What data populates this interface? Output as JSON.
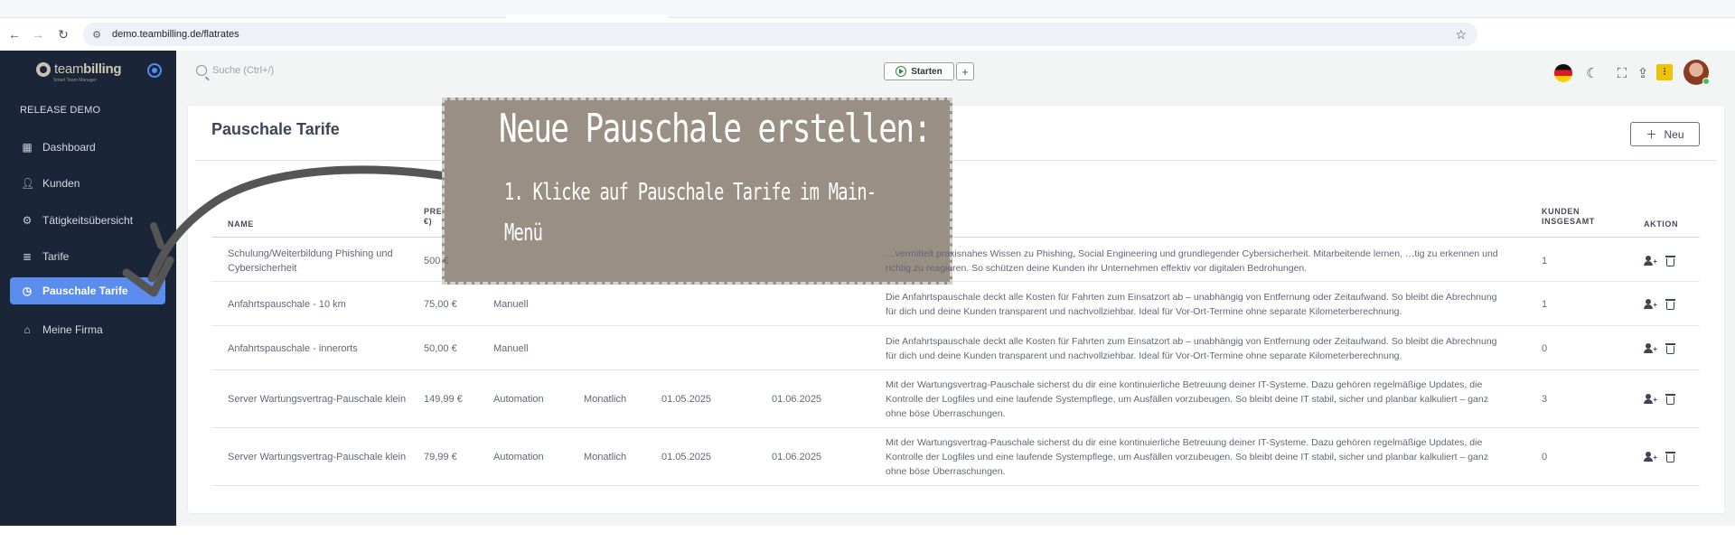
{
  "browser": {
    "url": "demo.teambilling.de/flatrates"
  },
  "sidebar": {
    "logo_bold": "billing",
    "logo_thin": "team",
    "logo_sub": "Smart Team Manager",
    "release": "RELEASE DEMO",
    "items": [
      {
        "label": "Dashboard",
        "icon": "dashboard-icon"
      },
      {
        "label": "Kunden",
        "icon": "user-icon"
      },
      {
        "label": "Tätigkeitsübersicht",
        "icon": "gears-icon"
      },
      {
        "label": "Tarife",
        "icon": "database-icon"
      },
      {
        "label": "Pauschale Tarife",
        "icon": "clock-icon",
        "active": true
      },
      {
        "label": "Meine Firma",
        "icon": "home-icon"
      }
    ]
  },
  "topbar": {
    "search_placeholder": "Suche (Ctrl+/)",
    "start_label": "Starten",
    "add_label": "+"
  },
  "card": {
    "title": "Pauschale Tarife",
    "new_label": "Neu"
  },
  "table": {
    "headers": {
      "name": "NAME",
      "preis_l1": "PRE",
      "preis_l2": "€)",
      "kunden_l1": "KUNDEN",
      "kunden_l2": "INSGESAMT",
      "aktion": "AKTION"
    },
    "rows": [
      {
        "name": "Schulung/Weiterbildung Phishing und Cybersicherheit",
        "preis": "500 €",
        "typ": "",
        "intervall": "",
        "start": "",
        "ende": "",
        "beschreibung": "…vermittelt praxisnahes Wissen zu Phishing, Social Engineering und grundlegender Cybersicherheit. Mitarbeitende lernen, …tig zu erkennen und richtig zu reagieren. So schützen deine Kunden ihr Unternehmen effektiv vor digitalen Bedrohungen.",
        "kunden": "1"
      },
      {
        "name": "Anfahrtspauschale - 10 km",
        "preis": "75,00 €",
        "typ": "Manuell",
        "intervall": "",
        "start": "",
        "ende": "",
        "beschreibung": "Die Anfahrtspauschale deckt alle Kosten für Fahrten zum Einsatzort ab – unabhängig von Entfernung oder Zeitaufwand. So bleibt die Abrechnung für dich und deine Kunden transparent und nachvollziehbar. Ideal für Vor-Ort-Termine ohne separate Kilometerberechnung.",
        "kunden": "1"
      },
      {
        "name": "Anfahrtspauschale - innerorts",
        "preis": "50,00 €",
        "typ": "Manuell",
        "intervall": "",
        "start": "",
        "ende": "",
        "beschreibung": "Die Anfahrtspauschale deckt alle Kosten für Fahrten zum Einsatzort ab – unabhängig von Entfernung oder Zeitaufwand. So bleibt die Abrechnung für dich und deine Kunden transparent und nachvollziehbar. Ideal für Vor-Ort-Termine ohne separate Kilometerberechnung.",
        "kunden": "0"
      },
      {
        "name": "Server Wartungsvertrag-Pauschale klein",
        "preis": "149,99 €",
        "typ": "Automation",
        "intervall": "Monatlich",
        "start": "01.05.2025",
        "ende": "01.06.2025",
        "beschreibung": "Mit der Wartungsvertrag-Pauschale sicherst du dir eine kontinuierliche Betreuung deiner IT-Systeme. Dazu gehören regelmäßige Updates, die Kontrolle der Logfiles und eine laufende Systempflege, um Ausfällen vorzubeugen. So bleibt deine IT stabil, sicher und planbar kalkuliert – ganz ohne böse Überraschungen.",
        "kunden": "3"
      },
      {
        "name": "Server Wartungsvertrag-Pauschale klein",
        "preis": "79,99 €",
        "typ": "Automation",
        "intervall": "Monatlich",
        "start": "01.05.2025",
        "ende": "01.06.2025",
        "beschreibung": "Mit der Wartungsvertrag-Pauschale sicherst du dir eine kontinuierliche Betreuung deiner IT-Systeme. Dazu gehören regelmäßige Updates, die Kontrolle der Logfiles und eine laufende Systempflege, um Ausfällen vorzubeugen. So bleibt deine IT stabil, sicher und planbar kalkuliert – ganz ohne böse Überraschungen.",
        "kunden": "0"
      }
    ]
  },
  "overlay": {
    "title": "Neue Pauschale erstellen:",
    "step": "1. Klicke auf Pauschale Tarife im Main-Menü"
  },
  "colors": {
    "sidebar_bg": "#1b2538",
    "active_nav": "#5b8def",
    "overlay_bg": "#9a8f85"
  }
}
